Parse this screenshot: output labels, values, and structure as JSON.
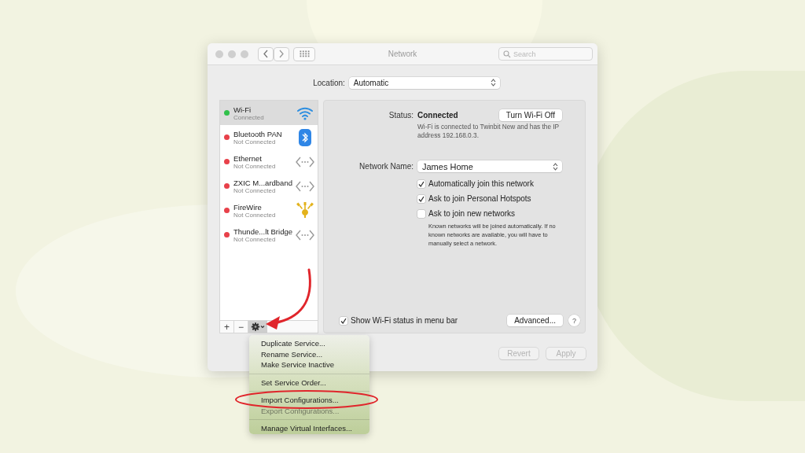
{
  "window": {
    "title": "Network"
  },
  "search": {
    "placeholder": "Search"
  },
  "location": {
    "label": "Location:",
    "value": "Automatic"
  },
  "services": [
    {
      "name": "Wi-Fi",
      "status": "Connected",
      "color": "#30c04a",
      "kind": "wifi",
      "selected": true
    },
    {
      "name": "Bluetooth PAN",
      "status": "Not Connected",
      "color": "#e8414a",
      "kind": "bluetooth",
      "selected": false
    },
    {
      "name": "Ethernet",
      "status": "Not Connected",
      "color": "#e8414a",
      "kind": "ethernet",
      "selected": false
    },
    {
      "name": "ZXIC M...ardband",
      "status": "Not Connected",
      "color": "#e8414a",
      "kind": "ethernet",
      "selected": false
    },
    {
      "name": "FireWire",
      "status": "Not Connected",
      "color": "#e8414a",
      "kind": "firewire",
      "selected": false
    },
    {
      "name": "Thunde...lt Bridge",
      "status": "Not Connected",
      "color": "#e8414a",
      "kind": "ethernet",
      "selected": false
    }
  ],
  "service_toolbar": {
    "add": "+",
    "remove": "−"
  },
  "status": {
    "label": "Status:",
    "value": "Connected",
    "button": "Turn Wi-Fi Off",
    "description": "Wi-Fi is connected to Twinbit New and has the IP address 192.168.0.3."
  },
  "network_name": {
    "label": "Network Name:",
    "value": "James Home"
  },
  "options": [
    {
      "label": "Automatically join this network",
      "checked": true
    },
    {
      "label": "Ask to join Personal Hotspots",
      "checked": true
    },
    {
      "label": "Ask to join new networks",
      "checked": false
    }
  ],
  "note": "Known networks will be joined automatically. If no known networks are available, you will have to manually select a network.",
  "show_status": {
    "label": "Show Wi-Fi status in menu bar",
    "checked": true
  },
  "advanced_button": "Advanced...",
  "help_button": "?",
  "footer_buttons": [
    {
      "label": "Revert",
      "disabled": true
    },
    {
      "label": "Apply",
      "disabled": true
    }
  ],
  "menu": [
    {
      "kind": "item",
      "label": "Duplicate Service...",
      "disabled": false
    },
    {
      "kind": "item",
      "label": "Rename Service...",
      "disabled": false
    },
    {
      "kind": "item",
      "label": "Make Service Inactive",
      "disabled": false
    },
    {
      "kind": "separator"
    },
    {
      "kind": "item",
      "label": "Set Service Order...",
      "disabled": false
    },
    {
      "kind": "separator"
    },
    {
      "kind": "item",
      "label": "Import Configurations...",
      "disabled": false
    },
    {
      "kind": "item",
      "label": "Export Configurations...",
      "disabled": true
    },
    {
      "kind": "separator"
    },
    {
      "kind": "item",
      "label": "Manage Virtual Interfaces...",
      "disabled": false
    }
  ]
}
